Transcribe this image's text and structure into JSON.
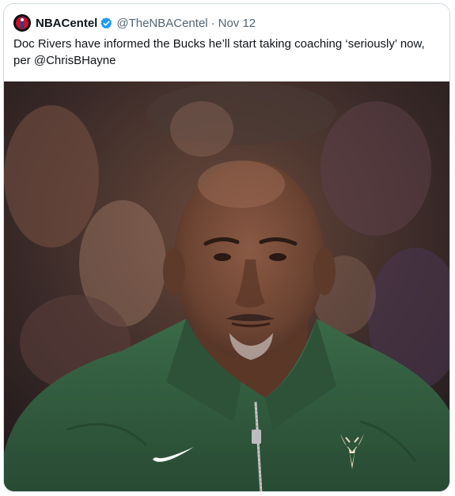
{
  "tweet": {
    "display_name": "NBACentel",
    "handle": "@TheNBACentel",
    "separator": "·",
    "date": "Nov 12",
    "text": "Doc Rivers have informed the Bucks he’ll start taking coaching ‘seriously’ now, per @ChrisBHayne"
  },
  "icons": {
    "avatar": "nbacentel-logo",
    "verified": "verified-badge-icon"
  },
  "colors": {
    "verified_blue": "#1d9bf0",
    "jacket_green": "#2f5a3c",
    "text_primary": "#0f1419",
    "text_secondary": "#536471"
  }
}
